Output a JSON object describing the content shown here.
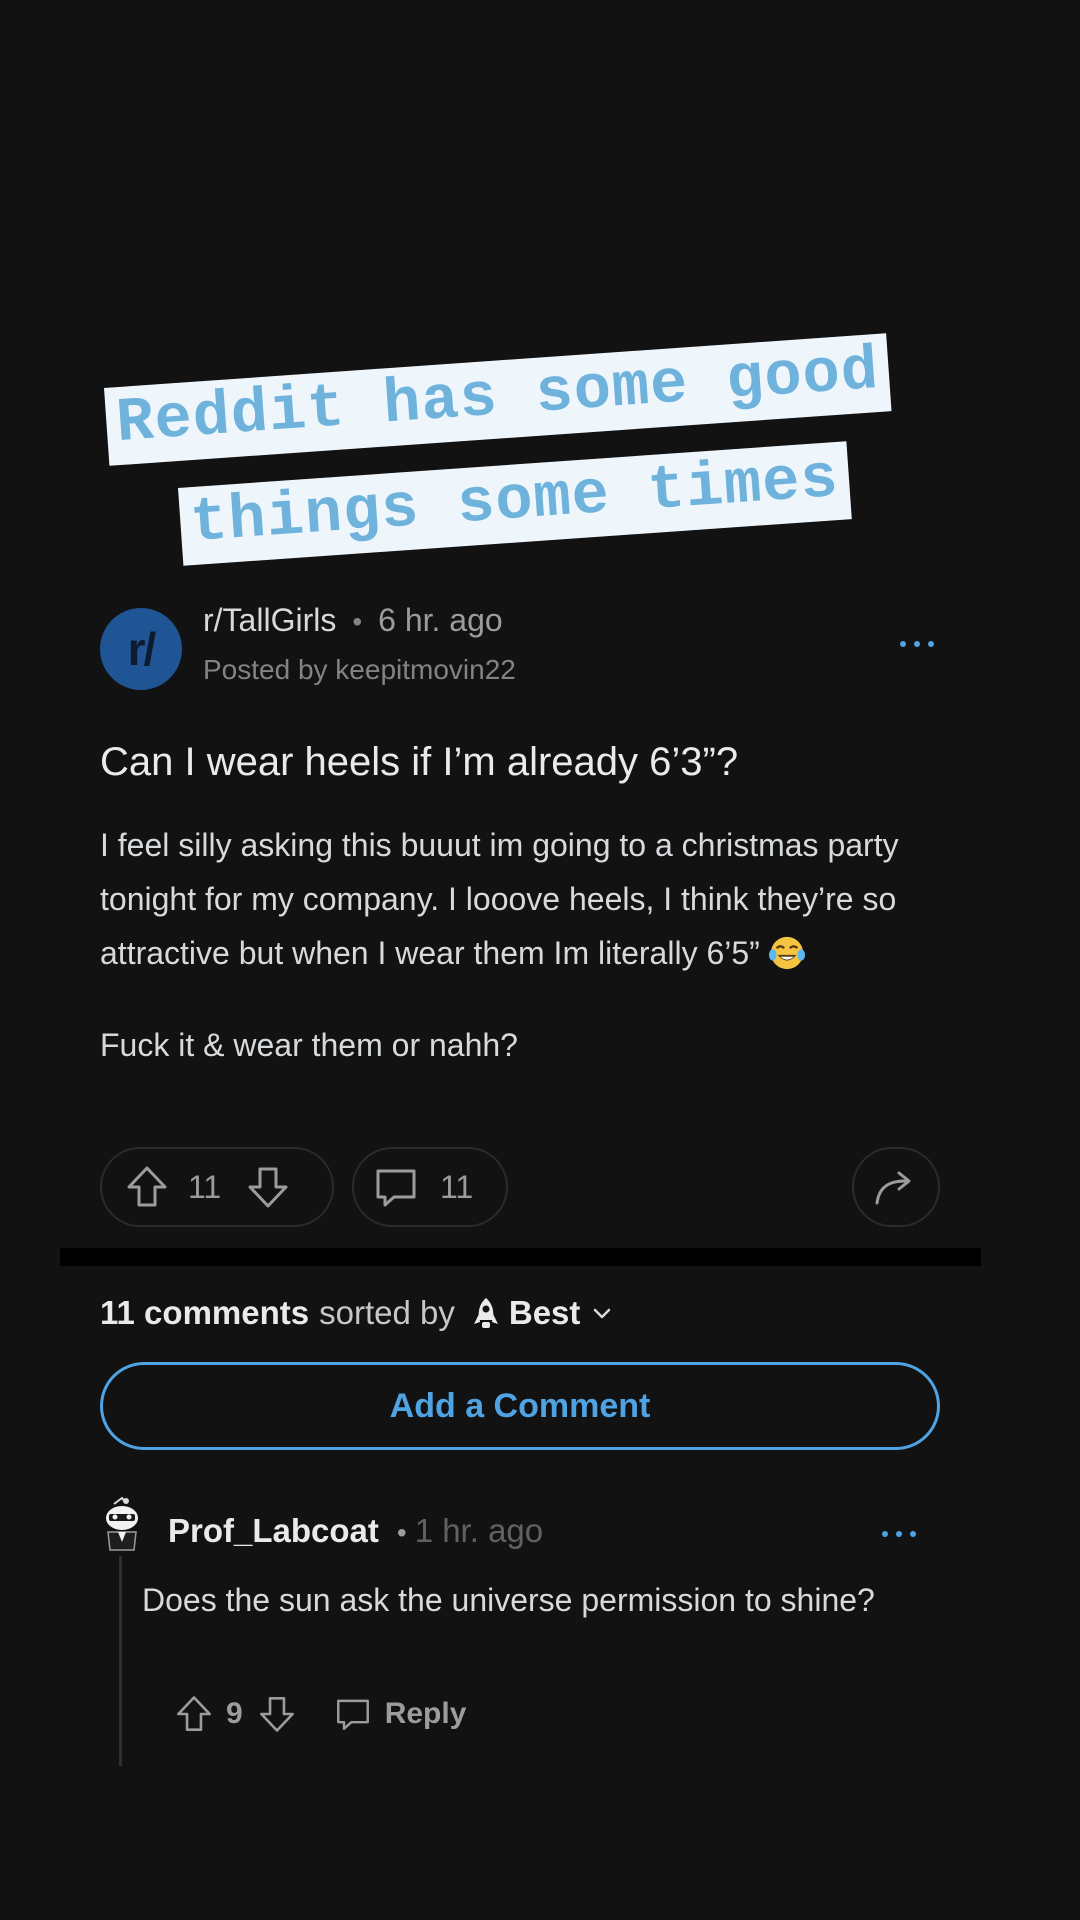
{
  "caption": {
    "line1": "Reddit has some good",
    "line2": "things some times"
  },
  "post": {
    "subreddit_icon": "r/",
    "subreddit": "r/TallGirls",
    "time": "6 hr. ago",
    "posted_by": "Posted by keepitmovin22",
    "title": "Can I wear heels if I’m already 6’3”?",
    "body_p1": "I feel silly asking this buuut im going to a christmas party tonight for my company. I looove heels, I think they’re so attractive but when I wear them Im literally 6’5”",
    "body_p2": "Fuck it & wear them or nahh?",
    "votes": "11",
    "comments_count": "11"
  },
  "sort": {
    "count_label": "11 comments",
    "sorted_by": "sorted by",
    "mode": "Best"
  },
  "add_comment": {
    "label": "Add a Comment"
  },
  "comment": {
    "author": "Prof_Labcoat",
    "time": "1 hr. ago",
    "text": "Does the sun ask the universe permission to shine?",
    "votes": "9",
    "reply_label": "Reply"
  },
  "colors": {
    "background": "#121213",
    "accent": "#4fa3e3",
    "caption_text": "#6fb3dd",
    "caption_bg": "#eef6fc",
    "subreddit_icon_bg": "#1f5595"
  },
  "icons": {
    "more": "more-options-icon",
    "upvote": "upvote-icon",
    "downvote": "downvote-icon",
    "comment": "comment-bubble-icon",
    "share": "share-arrow-icon",
    "sort": "rocket-icon",
    "chevron": "chevron-down-icon",
    "emoji": "laughing-tears-emoji"
  }
}
